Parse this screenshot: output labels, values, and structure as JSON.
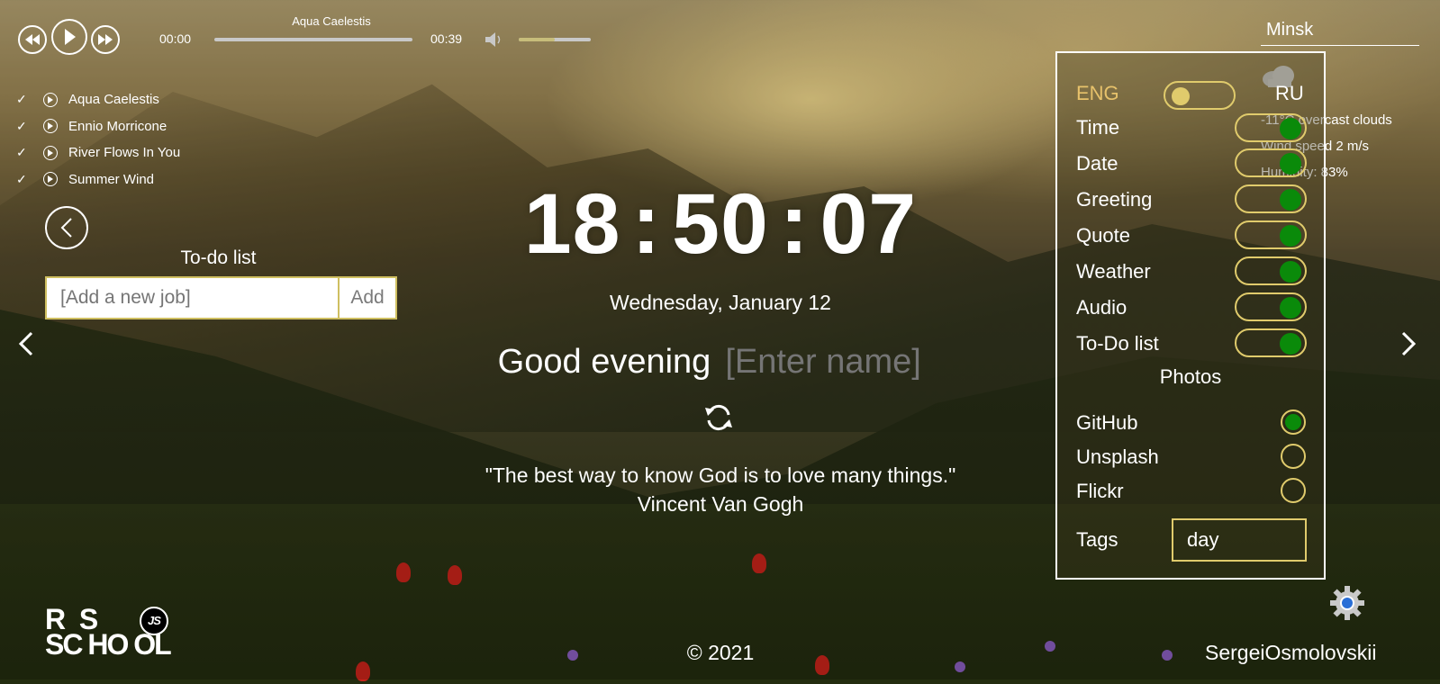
{
  "player": {
    "current_track": "Aqua Caelestis",
    "current_time": "00:00",
    "duration": "00:39",
    "progress": 0.0,
    "volume": 0.5
  },
  "playlist": [
    {
      "title": "Aqua Caelestis"
    },
    {
      "title": "Ennio Morricone"
    },
    {
      "title": "River Flows In You"
    },
    {
      "title": "Summer Wind"
    }
  ],
  "todo": {
    "title": "To-do list",
    "placeholder": "[Add a new job]",
    "add_label": "Add"
  },
  "clock": {
    "hours": "18",
    "minutes": "50",
    "seconds": "07",
    "sep": ":"
  },
  "date": "Wednesday, January 12",
  "greeting": {
    "text": "Good evening",
    "name_placeholder": "[Enter name]"
  },
  "quote": {
    "text": "\"The best way to know God is to love many things.\"",
    "author": "Vincent Van Gogh"
  },
  "weather": {
    "city": "Minsk",
    "icon": "cloud-icon",
    "temp": "-11°C",
    "desc": "overcast clouds",
    "wind": "Wind speed 2 m/s",
    "humidity": "Humidity: 83%"
  },
  "settings": {
    "lang_eng": "ENG",
    "lang_ru": "RU",
    "active_lang": "ENG",
    "toggles": [
      {
        "label": "Time",
        "on": true
      },
      {
        "label": "Date",
        "on": true
      },
      {
        "label": "Greeting",
        "on": true
      },
      {
        "label": "Quote",
        "on": true
      },
      {
        "label": "Weather",
        "on": true
      },
      {
        "label": "Audio",
        "on": true
      },
      {
        "label": "To-Do list",
        "on": true
      }
    ],
    "photos_title": "Photos",
    "sources": [
      {
        "label": "GitHub",
        "selected": true
      },
      {
        "label": "Unsplash",
        "selected": false
      },
      {
        "label": "Flickr",
        "selected": false
      }
    ],
    "tags_label": "Tags",
    "tags_value": "day"
  },
  "footer": {
    "copyright": "© 2021",
    "author": "SergeiOsmolovskii",
    "logo_line1": "R  S",
    "logo_line2": "SC HO OL",
    "logo_badge": "JS"
  },
  "colors": {
    "accent": "#e0cb6c",
    "toggle_on": "#0a8a0a",
    "lang_active": "#e7c26b"
  }
}
